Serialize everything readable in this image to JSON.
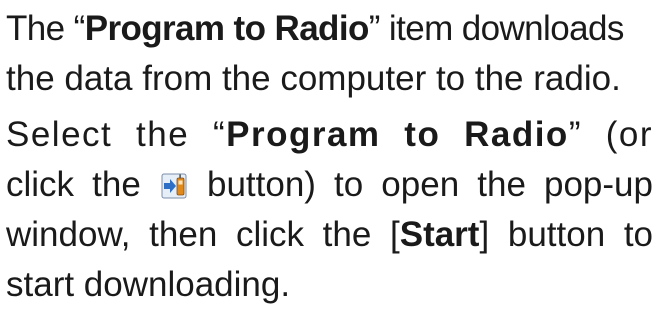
{
  "paragraph1": {
    "line1_pre": "The “",
    "line1_bold": "Program to Radio",
    "line1_post": "” item downloads",
    "line2": "the data from the computer to the radio."
  },
  "paragraph2": {
    "line1_pre": "Select the “",
    "line1_bold": "Program to Radio",
    "line1_post": "” (or",
    "line2_pre": "click the",
    "line2_post": "button) to open the pop-up",
    "line3_pre": "window, then click the [",
    "line3_bold": "Start",
    "line3_post": "] button to",
    "line4": "start downloading."
  },
  "icons": {
    "program_to_radio": "program-to-radio-icon"
  },
  "colors": {
    "text": "#1a1a1a",
    "icon_blue": "#2d6fc4",
    "icon_orange": "#e08a1e"
  }
}
